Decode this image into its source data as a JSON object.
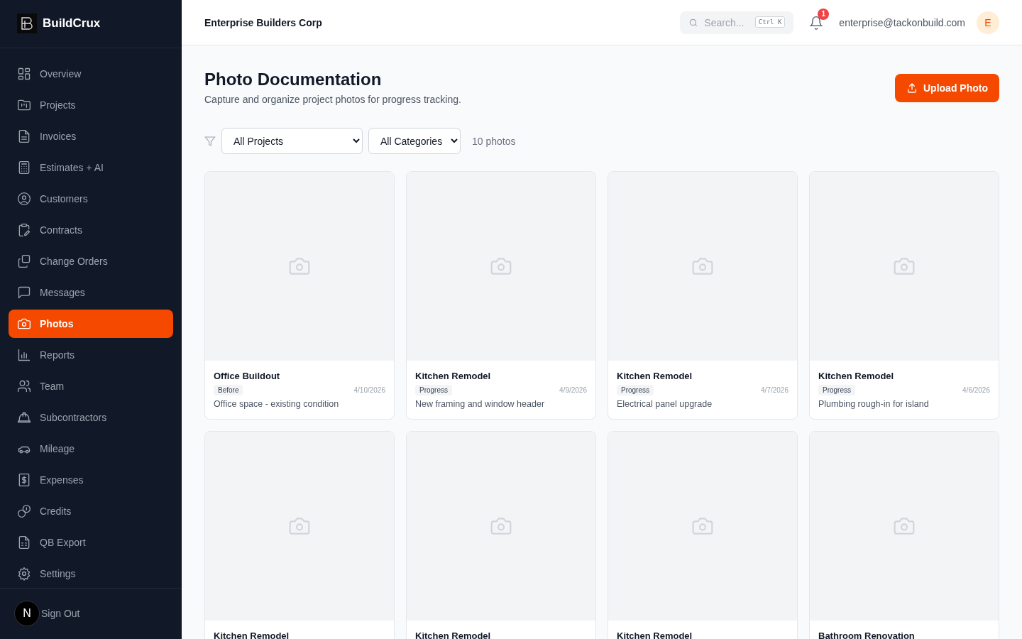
{
  "brand": {
    "name": "BuildCrux"
  },
  "sidebar": {
    "items": [
      {
        "label": "Overview",
        "selected": false
      },
      {
        "label": "Projects",
        "selected": false
      },
      {
        "label": "Invoices",
        "selected": false
      },
      {
        "label": "Estimates + AI",
        "selected": false
      },
      {
        "label": "Customers",
        "selected": false
      },
      {
        "label": "Contracts",
        "selected": false
      },
      {
        "label": "Change Orders",
        "selected": false
      },
      {
        "label": "Messages",
        "selected": false
      },
      {
        "label": "Photos",
        "selected": true
      },
      {
        "label": "Reports",
        "selected": false
      },
      {
        "label": "Team",
        "selected": false
      },
      {
        "label": "Subcontractors",
        "selected": false
      },
      {
        "label": "Mileage",
        "selected": false
      },
      {
        "label": "Expenses",
        "selected": false
      },
      {
        "label": "Credits",
        "selected": false
      },
      {
        "label": "QB Export",
        "selected": false
      },
      {
        "label": "Settings",
        "selected": false
      }
    ],
    "footer": {
      "avatar": "N",
      "label": "Sign Out"
    }
  },
  "header": {
    "company": "Enterprise Builders Corp",
    "search": {
      "placeholder": "Search...",
      "shortcut": "Ctrl K"
    },
    "notifications": "1",
    "email": "enterprise@tackonbuild.com",
    "avatar": "E"
  },
  "page": {
    "title": "Photo Documentation",
    "subtitle": "Capture and organize project photos for progress tracking.",
    "upload_button": "Upload Photo"
  },
  "filters": {
    "project": "All Projects",
    "category": "All Categories",
    "count": "10 photos"
  },
  "photos": [
    {
      "title": "Office Buildout",
      "tag": "Before",
      "date": "4/10/2026",
      "description": "Office space - existing condition"
    },
    {
      "title": "Kitchen Remodel",
      "tag": "Progress",
      "date": "4/9/2026",
      "description": "New framing and window header"
    },
    {
      "title": "Kitchen Remodel",
      "tag": "Progress",
      "date": "4/7/2026",
      "description": "Electrical panel upgrade"
    },
    {
      "title": "Kitchen Remodel",
      "tag": "Progress",
      "date": "4/6/2026",
      "description": "Plumbing rough-in for island"
    },
    {
      "title": "Kitchen Remodel"
    },
    {
      "title": "Kitchen Remodel"
    },
    {
      "title": "Kitchen Remodel"
    },
    {
      "title": "Bathroom Renovation"
    }
  ]
}
